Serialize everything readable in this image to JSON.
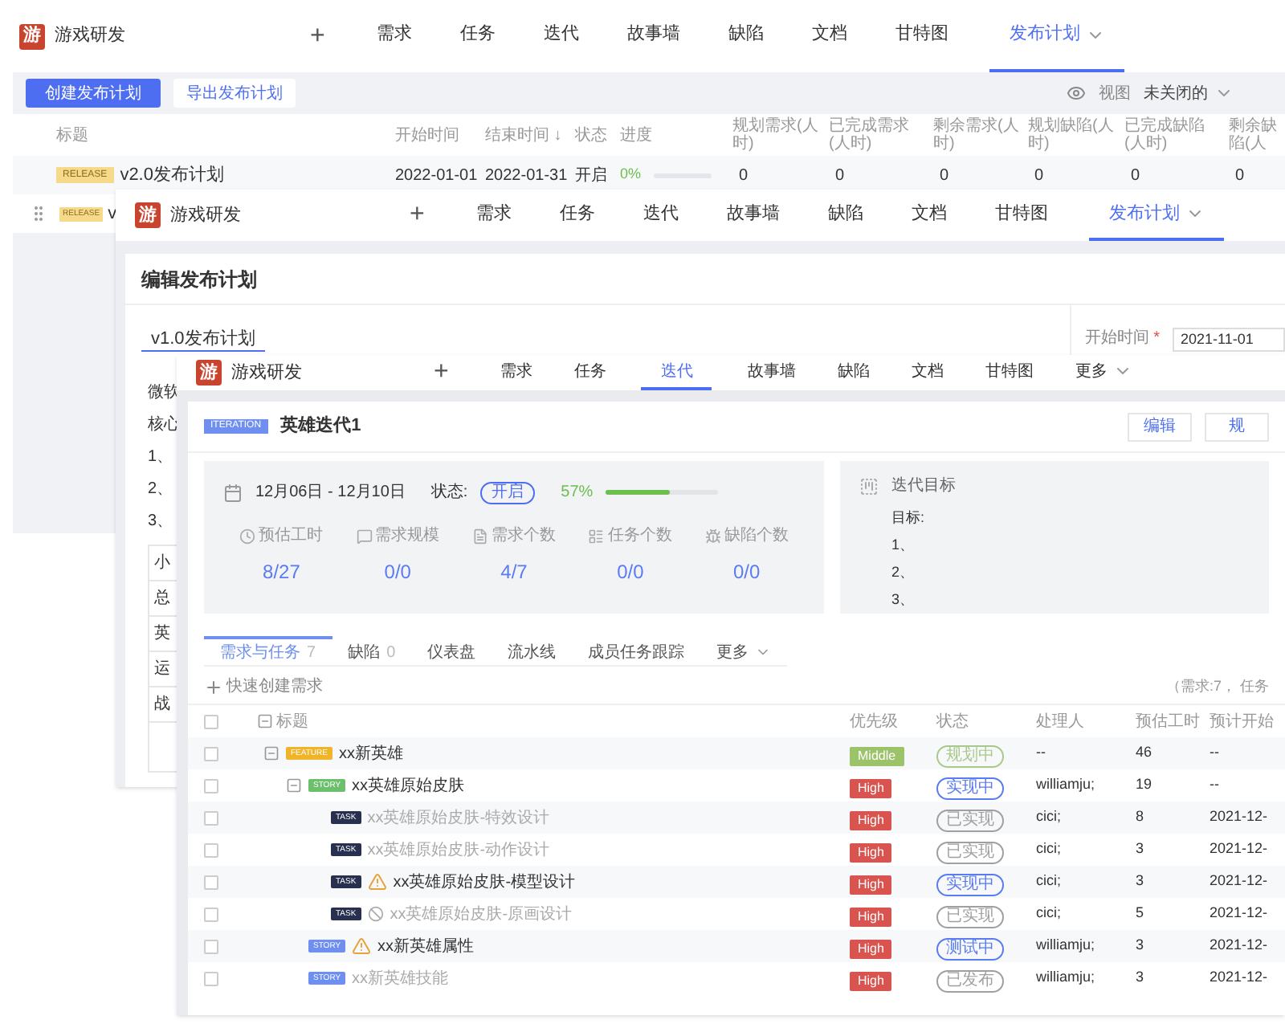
{
  "release_list_window": {
    "nav": {
      "logo": "游",
      "project": "游戏研发",
      "add": "+",
      "tabs": [
        {
          "label": "需求",
          "selected": false,
          "menu": false
        },
        {
          "label": "任务",
          "selected": false,
          "menu": false
        },
        {
          "label": "迭代",
          "selected": false,
          "menu": false
        },
        {
          "label": "故事墙",
          "selected": false,
          "menu": false
        },
        {
          "label": "缺陷",
          "selected": false,
          "menu": false
        },
        {
          "label": "文档",
          "selected": false,
          "menu": false
        },
        {
          "label": "甘特图",
          "selected": false,
          "menu": false
        },
        {
          "label": "发布计划",
          "selected": true,
          "menu": true
        }
      ]
    },
    "toolbar": {
      "create_button": "创建发布计划",
      "export_button": "导出发布计划",
      "view_label": "视图",
      "view_filter": "未关闭的"
    },
    "table": {
      "columns": [
        "标题",
        "开始时间",
        "结束时间 ↓",
        "状态",
        "进度",
        "规划需求(人时)",
        "已完成需求(人时)",
        "剩余需求(人时)",
        "规划缺陷(人时)",
        "已完成缺陷(人时)",
        "剩余缺陷(人"
      ],
      "rows": [
        {
          "tag": "RELEASE",
          "title": "v2.0发布计划",
          "start": "2022-01-01",
          "end": "2022-01-31",
          "status": "开启",
          "progress": "0%",
          "level": 0,
          "values": [
            "0",
            "0",
            "0",
            "0",
            "0",
            "0"
          ]
        },
        {
          "tag": "RELEASE",
          "title": "v"
        }
      ]
    }
  },
  "edit_plan_window": {
    "nav": {
      "logo": "游",
      "project": "游戏研发",
      "add": "+",
      "tabs": [
        {
          "label": "需求",
          "selected": false,
          "menu": false
        },
        {
          "label": "任务",
          "selected": false,
          "menu": false
        },
        {
          "label": "迭代",
          "selected": false,
          "menu": false
        },
        {
          "label": "故事墙",
          "selected": false,
          "menu": false
        },
        {
          "label": "缺陷",
          "selected": false,
          "menu": false
        },
        {
          "label": "文档",
          "selected": false,
          "menu": false
        },
        {
          "label": "甘特图",
          "selected": false,
          "menu": false
        },
        {
          "label": "发布计划",
          "selected": true,
          "menu": true
        }
      ]
    },
    "title": "编辑发布计划",
    "name_value": "v1.0发布计划",
    "lines": [
      "微软",
      "核心",
      "1、",
      "2、",
      "3、"
    ],
    "table_cells": [
      "小",
      "总",
      "英",
      "运",
      "战"
    ],
    "start_label": "开始时间",
    "required_mark": "*",
    "start_value": "2021-11-01"
  },
  "iteration_window": {
    "nav": {
      "logo": "游",
      "project": "游戏研发",
      "add": "+",
      "tabs": [
        {
          "label": "需求",
          "selected": false,
          "menu": false
        },
        {
          "label": "任务",
          "selected": false,
          "menu": false
        },
        {
          "label": "迭代",
          "selected": true,
          "menu": false
        },
        {
          "label": "故事墙",
          "selected": false,
          "menu": false
        },
        {
          "label": "缺陷",
          "selected": false,
          "menu": false
        },
        {
          "label": "文档",
          "selected": false,
          "menu": false
        },
        {
          "label": "甘特图",
          "selected": false,
          "menu": false
        },
        {
          "label": "更多",
          "selected": false,
          "menu": true
        }
      ]
    },
    "tag": "ITERATION",
    "title": "英雄迭代1",
    "buttons": [
      "编辑",
      "规"
    ],
    "dates": "12月06日 - 12月10日",
    "status_label": "状态:",
    "status": "开启",
    "progress": "57%",
    "level": 0.57,
    "metrics": [
      {
        "label": "预估工时",
        "value": "8/27"
      },
      {
        "label": "需求规模",
        "value": "0/0"
      },
      {
        "label": "需求个数",
        "value": "4/7"
      },
      {
        "label": "任务个数",
        "value": "0/0"
      },
      {
        "label": "缺陷个数",
        "value": "0/0"
      }
    ],
    "goal_title": "迭代目标",
    "goal_lines": [
      "目标:",
      "1、",
      "2、",
      "3、"
    ],
    "subtabs": [
      {
        "label": "需求与任务",
        "count": "7",
        "selected": true,
        "menu": false
      },
      {
        "label": "缺陷",
        "count": "0",
        "selected": false,
        "menu": false
      },
      {
        "label": "仪表盘",
        "selected": false,
        "menu": false
      },
      {
        "label": "流水线",
        "selected": false,
        "menu": false
      },
      {
        "label": "成员任务跟踪",
        "selected": false,
        "menu": false
      },
      {
        "label": "更多",
        "selected": false,
        "menu": true
      }
    ],
    "quick_create": "快速创建需求",
    "summary": "（需求:7， 任务",
    "columns": [
      "标题",
      "优先级",
      "状态",
      "处理人",
      "预估工时",
      "预计开始"
    ],
    "header_checked": false,
    "items": [
      {
        "tag": {
          "label": "FEATURE",
          "color": "#f0b429"
        },
        "title": "xx新英雄",
        "done": false,
        "checked": false,
        "priority": {
          "label": "Middle",
          "color": "#9cc26a"
        },
        "status": {
          "label": "规划中",
          "color": "#a9c98c"
        },
        "assignee": "--",
        "hours": "46",
        "start": "--",
        "children": [
          {
            "tag": {
              "label": "STORY",
              "color": "#6cbf6c"
            },
            "title": "xx英雄原始皮肤",
            "done": false,
            "checked": false,
            "priority": {
              "label": "High",
              "color": "#d9534f"
            },
            "status": {
              "label": "实现中",
              "color": "#5b7bf0"
            },
            "assignee": "williamju;",
            "hours": "19",
            "start": "--",
            "children": [
              {
                "tag": {
                  "label": "TASK",
                  "color": "#27304f"
                },
                "title": "xx英雄原始皮肤-特效设计",
                "done": true,
                "checked": false,
                "priority": {
                  "label": "High",
                  "color": "#d9534f"
                },
                "status": {
                  "label": "已实现",
                  "color": "#a0a0a0"
                },
                "assignee": "cici;",
                "hours": "8",
                "start": "2021-12-"
              },
              {
                "tag": {
                  "label": "TASK",
                  "color": "#27304f"
                },
                "title": "xx英雄原始皮肤-动作设计",
                "done": true,
                "checked": false,
                "priority": {
                  "label": "High",
                  "color": "#d9534f"
                },
                "status": {
                  "label": "已实现",
                  "color": "#a0a0a0"
                },
                "assignee": "cici;",
                "hours": "3",
                "start": "2021-12-"
              },
              {
                "tag": {
                  "label": "TASK",
                  "color": "#27304f"
                },
                "kind": "warning",
                "title": "xx英雄原始皮肤-模型设计",
                "done": false,
                "checked": false,
                "priority": {
                  "label": "High",
                  "color": "#d9534f"
                },
                "status": {
                  "label": "实现中",
                  "color": "#5b7bf0"
                },
                "assignee": "cici;",
                "hours": "3",
                "start": "2021-12-"
              },
              {
                "tag": {
                  "label": "TASK",
                  "color": "#27304f"
                },
                "kind": "blocked",
                "title": "xx英雄原始皮肤-原画设计",
                "done": true,
                "checked": false,
                "priority": {
                  "label": "High",
                  "color": "#d9534f"
                },
                "status": {
                  "label": "已实现",
                  "color": "#a0a0a0"
                },
                "assignee": "cici;",
                "hours": "5",
                "start": "2021-12-"
              }
            ]
          },
          {
            "tag": {
              "label": "STORY",
              "color": "#6e8ff0"
            },
            "kind": "warning",
            "title": "xx新英雄属性",
            "done": false,
            "checked": false,
            "priority": {
              "label": "High",
              "color": "#d9534f"
            },
            "status": {
              "label": "测试中",
              "color": "#5b7bf0"
            },
            "assignee": "williamju;",
            "hours": "3",
            "start": "2021-12-"
          },
          {
            "tag": {
              "label": "STORY",
              "color": "#6e8ff0"
            },
            "title": "xx新英雄技能",
            "done": true,
            "checked": false,
            "priority": {
              "label": "High",
              "color": "#d9534f"
            },
            "status": {
              "label": "已发布",
              "color": "#a0a0a0"
            },
            "assignee": "williamju;",
            "hours": "3",
            "start": "2021-12-"
          }
        ]
      }
    ]
  }
}
